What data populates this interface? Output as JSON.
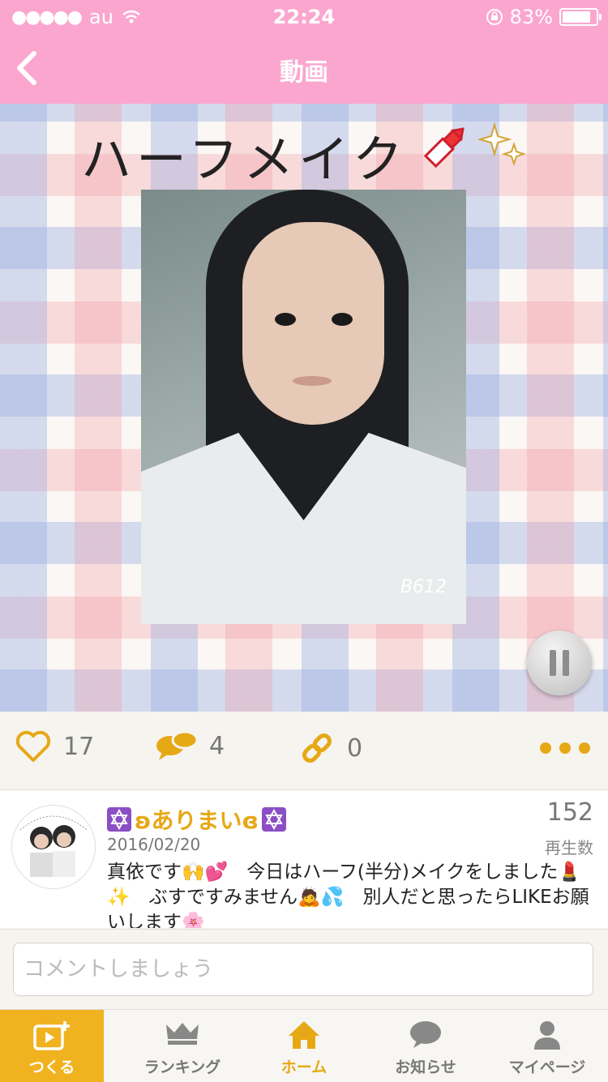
{
  "status": {
    "carrier": "au",
    "time": "22:24",
    "battery": "83%"
  },
  "nav": {
    "title": "動画"
  },
  "media": {
    "overlay_title": "ハーフメイク",
    "watermark": "B612"
  },
  "actions": {
    "likes": "17",
    "comments": "4",
    "shares": "0"
  },
  "post": {
    "author": "ʚありまいɞ",
    "date": "2016/02/20",
    "plays": "152",
    "plays_label": "再生数",
    "description": "真依です🙌💕　今日はハーフ(半分)メイクをしました💄✨　ぶすですみません🙇💦　別人だと思ったらLIKEお願いします🌸"
  },
  "comment": {
    "placeholder": "コメントしましょう"
  },
  "tabs": [
    {
      "label": "つくる"
    },
    {
      "label": "ランキング"
    },
    {
      "label": "ホーム"
    },
    {
      "label": "お知らせ"
    },
    {
      "label": "マイページ"
    }
  ],
  "colors": {
    "pink": "#fba6cf",
    "accent": "#e7a816",
    "create_tab": "#f0b21f"
  }
}
